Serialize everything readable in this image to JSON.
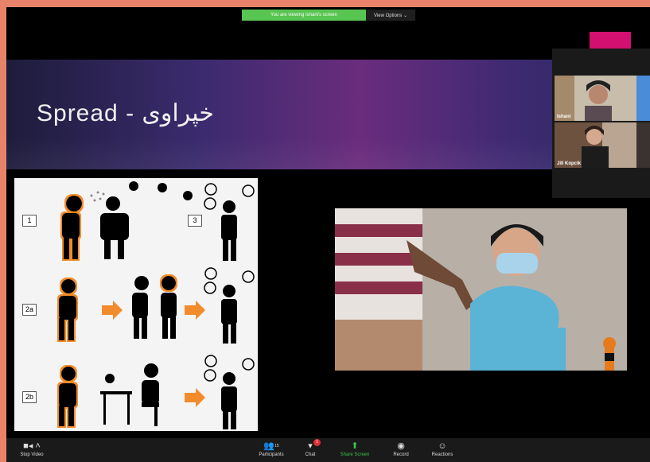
{
  "share_banner": {
    "message": "You are viewing Ishani's screen",
    "view_options": "View Options ⌄"
  },
  "slide": {
    "title": "Spread - خپراوی",
    "row_labels": [
      "1",
      "3",
      "2a",
      "2b"
    ]
  },
  "gallery": {
    "participants": [
      "Ishani",
      "Jill Kopcik"
    ]
  },
  "toolbar": {
    "stop_video": "Stop Video",
    "participants": "Participants",
    "participant_count": "15",
    "chat": "Chat",
    "chat_badge": "1",
    "share_screen": "Share Screen",
    "record": "Record",
    "reactions": "Reactions"
  },
  "colors": {
    "share_green": "#58c451",
    "accent_magenta": "#d2106f",
    "orange_glow": "#f28b2c"
  }
}
